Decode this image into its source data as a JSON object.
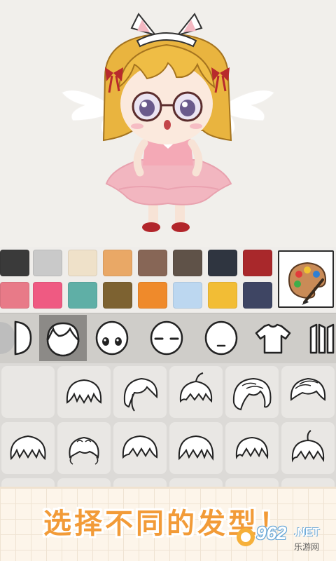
{
  "palette": {
    "row1": [
      "#3a3a3a",
      "#c9c9c9",
      "#efe1c9",
      "#e9a866",
      "#876656",
      "#5f5248",
      "#2f3540",
      "#a9282b"
    ],
    "row2": [
      "#e87a88",
      "#ef5a82",
      "#5fafa6",
      "#7d6231",
      "#ef8a2b",
      "#bcd7f0",
      "#f2bd35",
      "#3e4563"
    ]
  },
  "categories": [
    {
      "name": "skin-tone",
      "icon": "skin-half-icon"
    },
    {
      "name": "hair",
      "icon": "hair-head-icon",
      "active": true
    },
    {
      "name": "eyes",
      "icon": "eyes-face-icon"
    },
    {
      "name": "eyebrows",
      "icon": "closed-eyes-face-icon"
    },
    {
      "name": "mouth",
      "icon": "mouth-face-icon"
    },
    {
      "name": "top",
      "icon": "tshirt-icon"
    },
    {
      "name": "dress",
      "icon": "dress-icon"
    }
  ],
  "hair_styles": [
    "blank",
    "bob",
    "side-swept",
    "spiky-short",
    "wavy-long",
    "pompadour",
    "messy",
    "curly",
    "fluffy-bangs",
    "short-bangs",
    "layered",
    "sprout"
  ],
  "banner": {
    "text": "选择不同的发型！"
  },
  "watermark": {
    "number": "962",
    "domain": ".NET",
    "sub": "乐游网"
  },
  "brush_button": {
    "icon": "palette-brush-icon"
  }
}
